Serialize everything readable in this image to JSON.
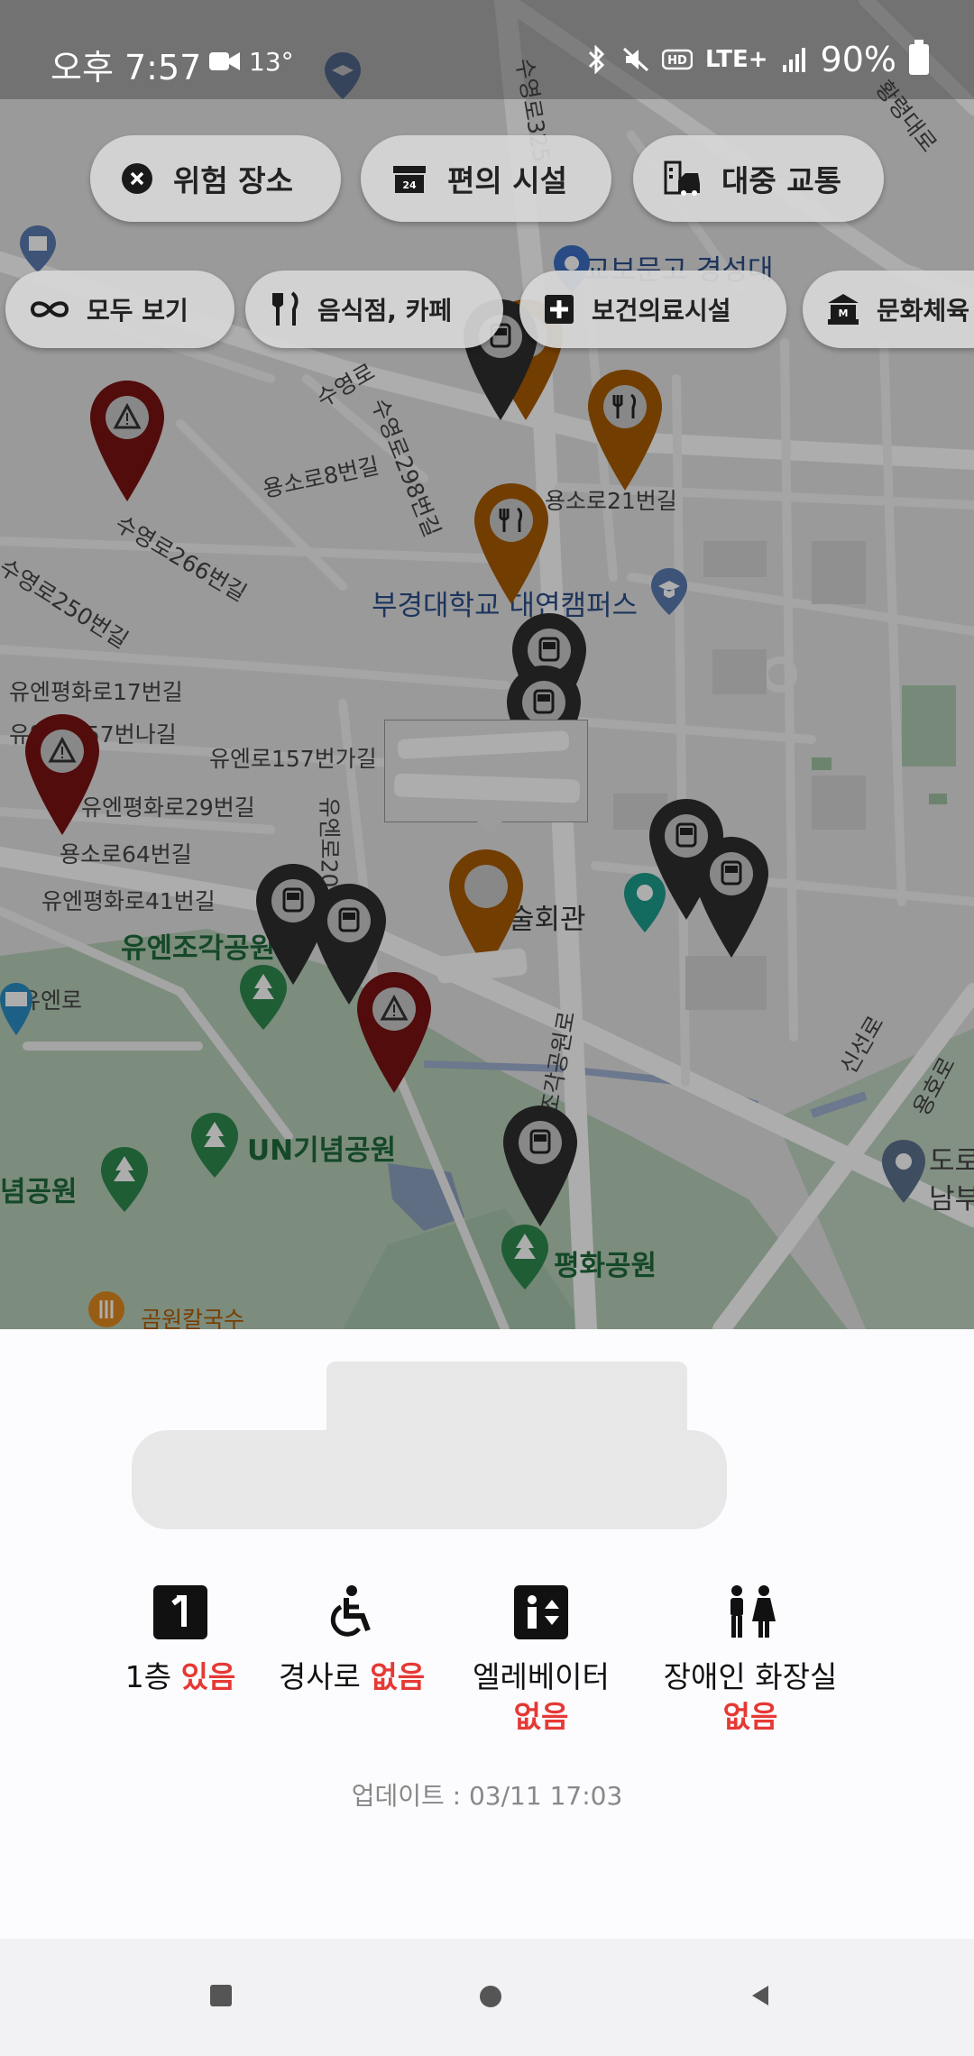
{
  "status_bar": {
    "time": "오후 7:57",
    "temperature": "13°",
    "battery": "90%",
    "network": "LTE+",
    "icons": [
      "video-camera-icon",
      "bluetooth-icon",
      "mute-icon",
      "hd-icon",
      "lte-icon",
      "signal-icon",
      "battery-icon"
    ]
  },
  "categories_row1": [
    {
      "label": "위험 장소",
      "icon": "close-circle-icon"
    },
    {
      "label": "편의 시설",
      "icon": "store-icon"
    },
    {
      "label": "대중 교통",
      "icon": "transit-icon"
    }
  ],
  "categories_row2": [
    {
      "label": "모두 보기",
      "icon": "infinity-icon"
    },
    {
      "label": "음식점, 카페",
      "icon": "restaurant-icon"
    },
    {
      "label": "보건의료시설",
      "icon": "medical-cross-icon"
    },
    {
      "label": "문화체육",
      "icon": "museum-icon"
    }
  ],
  "map_labels": {
    "l1": "수영로",
    "l2": "수영로298번길",
    "l3": "용소로8번길",
    "l4": "수영로266번길",
    "l5": "수영로250번길",
    "l6": "용소로21번길",
    "l7": "부경대학교 대연캠퍼스",
    "l8": "유엔평화로17번길",
    "l9": "유엔로157번나길",
    "l10": "유엔로157번가길",
    "l11": "유엔평화로29번길",
    "l12": "용소로64번길",
    "l13": "유엔평화로41번길",
    "l14": "유엔조각공원",
    "l15": "유엔로",
    "l16": "UN기념공원",
    "l17": "념공원",
    "l18": "평화공원",
    "l19": "신선로",
    "l20": "용호로",
    "l21": "황령대로",
    "l22": "교보문고 경성대",
    "l23": "곰원칼국수",
    "l24": "술회관",
    "l25": "조각공원로",
    "l26": "도로",
    "l27": "남부",
    "l28": "유엔로20",
    "l29": "수영로325"
  },
  "sheet": {
    "features": [
      {
        "label": "1층",
        "status": "있음",
        "icon": "floor-one-icon"
      },
      {
        "label": "경사로",
        "status": "없음",
        "icon": "wheelchair-icon"
      },
      {
        "label": "엘레베이터",
        "status": "없음",
        "icon": "elevator-icon"
      },
      {
        "label": "장애인 화장실",
        "status": "없음",
        "icon": "restroom-icon"
      }
    ],
    "update_text": "업데이트 : 03/11 17:03"
  },
  "colors": {
    "danger_marker": "#7a1212",
    "facility_marker": "#a85a00",
    "transit_marker": "#2f2f2f",
    "status_red": "#e53935"
  },
  "nav": [
    "recent-apps-icon",
    "home-icon",
    "back-icon"
  ]
}
